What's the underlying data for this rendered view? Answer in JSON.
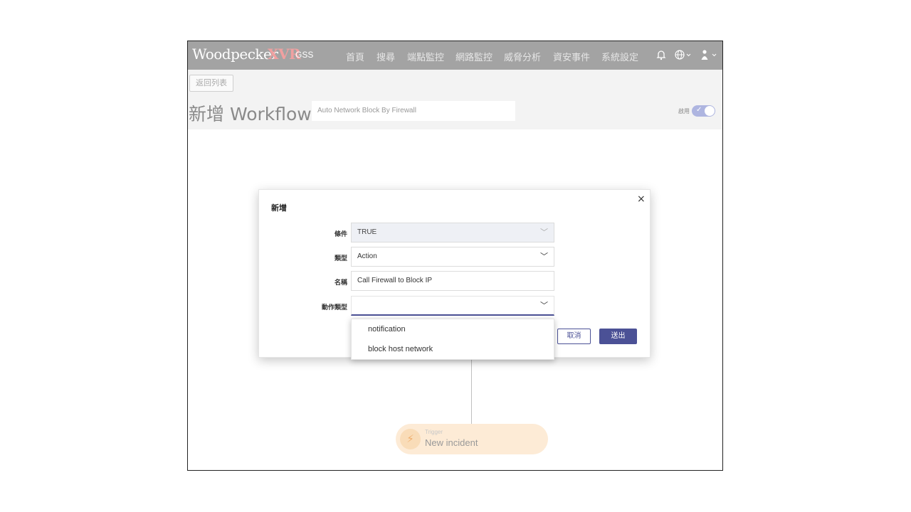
{
  "header": {
    "logo_text": "Woodpecker",
    "logo_suffix": "XVR",
    "product": "GSS",
    "nav": [
      "首頁",
      "搜尋",
      "端點監控",
      "網路監控",
      "威脅分析",
      "資安事件",
      "系統設定"
    ],
    "icons": [
      "bell-icon",
      "globe-icon",
      "user-icon"
    ]
  },
  "subheader": {
    "back_label": "返回列表",
    "page_title": "新增 Workflow",
    "workflow_name": "Auto Network Block By Firewall",
    "enable_label": "啟用",
    "enabled": true
  },
  "modal": {
    "title": "新增",
    "close": "×",
    "fields": {
      "condition": {
        "label": "條件",
        "value": "TRUE"
      },
      "type": {
        "label": "類型",
        "value": "Action"
      },
      "name": {
        "label": "名稱",
        "value": "Call Firewall to Block IP"
      },
      "action_type": {
        "label": "動作類型",
        "value": ""
      }
    },
    "cancel_label": "取消",
    "submit_label": "送出"
  },
  "dropdown": {
    "options": [
      "notification",
      "block host network"
    ]
  },
  "trigger": {
    "label": "Trigger",
    "value": "New incident"
  },
  "colors": {
    "accent": "#4b5196",
    "topbar": "#a3a3a3",
    "trigger_bg": "#fdebd6"
  }
}
